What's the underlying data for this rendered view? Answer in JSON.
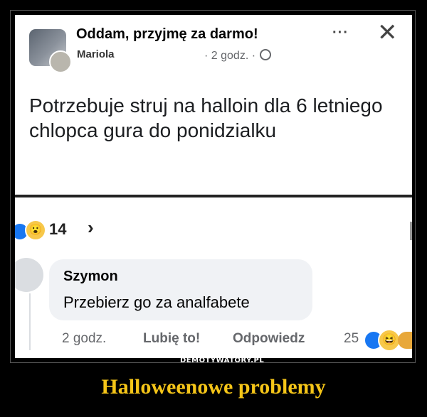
{
  "post": {
    "group_name": "Oddam, przyjmę za darmo!",
    "author": "Mariola",
    "time": "· 2 godz. ·",
    "audience_icon": "globe-icon",
    "more_label": "···",
    "close_label": "✕",
    "text": "Potrzebuje struj na halloin dla 6 letniego chlopca gura do ponidzialku"
  },
  "reactions": {
    "count": "14",
    "icons": [
      "like-icon",
      "wow-icon"
    ],
    "chevron": "›"
  },
  "comment": {
    "author": "Szymon",
    "text": "Przebierz go za analfabete",
    "time": "2 godz.",
    "like_label": "Lubię to!",
    "reply_label": "Odpowiedz",
    "reaction_count": "25",
    "reaction_icons": [
      "like-icon",
      "haha-icon"
    ]
  },
  "watermark": "DEMOTYWATORY.PL",
  "caption": "Halloweenowe problemy",
  "colors": {
    "background": "#000000",
    "caption": "#f5c518",
    "like_blue": "#1877f2",
    "secondary_text": "#65676b"
  }
}
